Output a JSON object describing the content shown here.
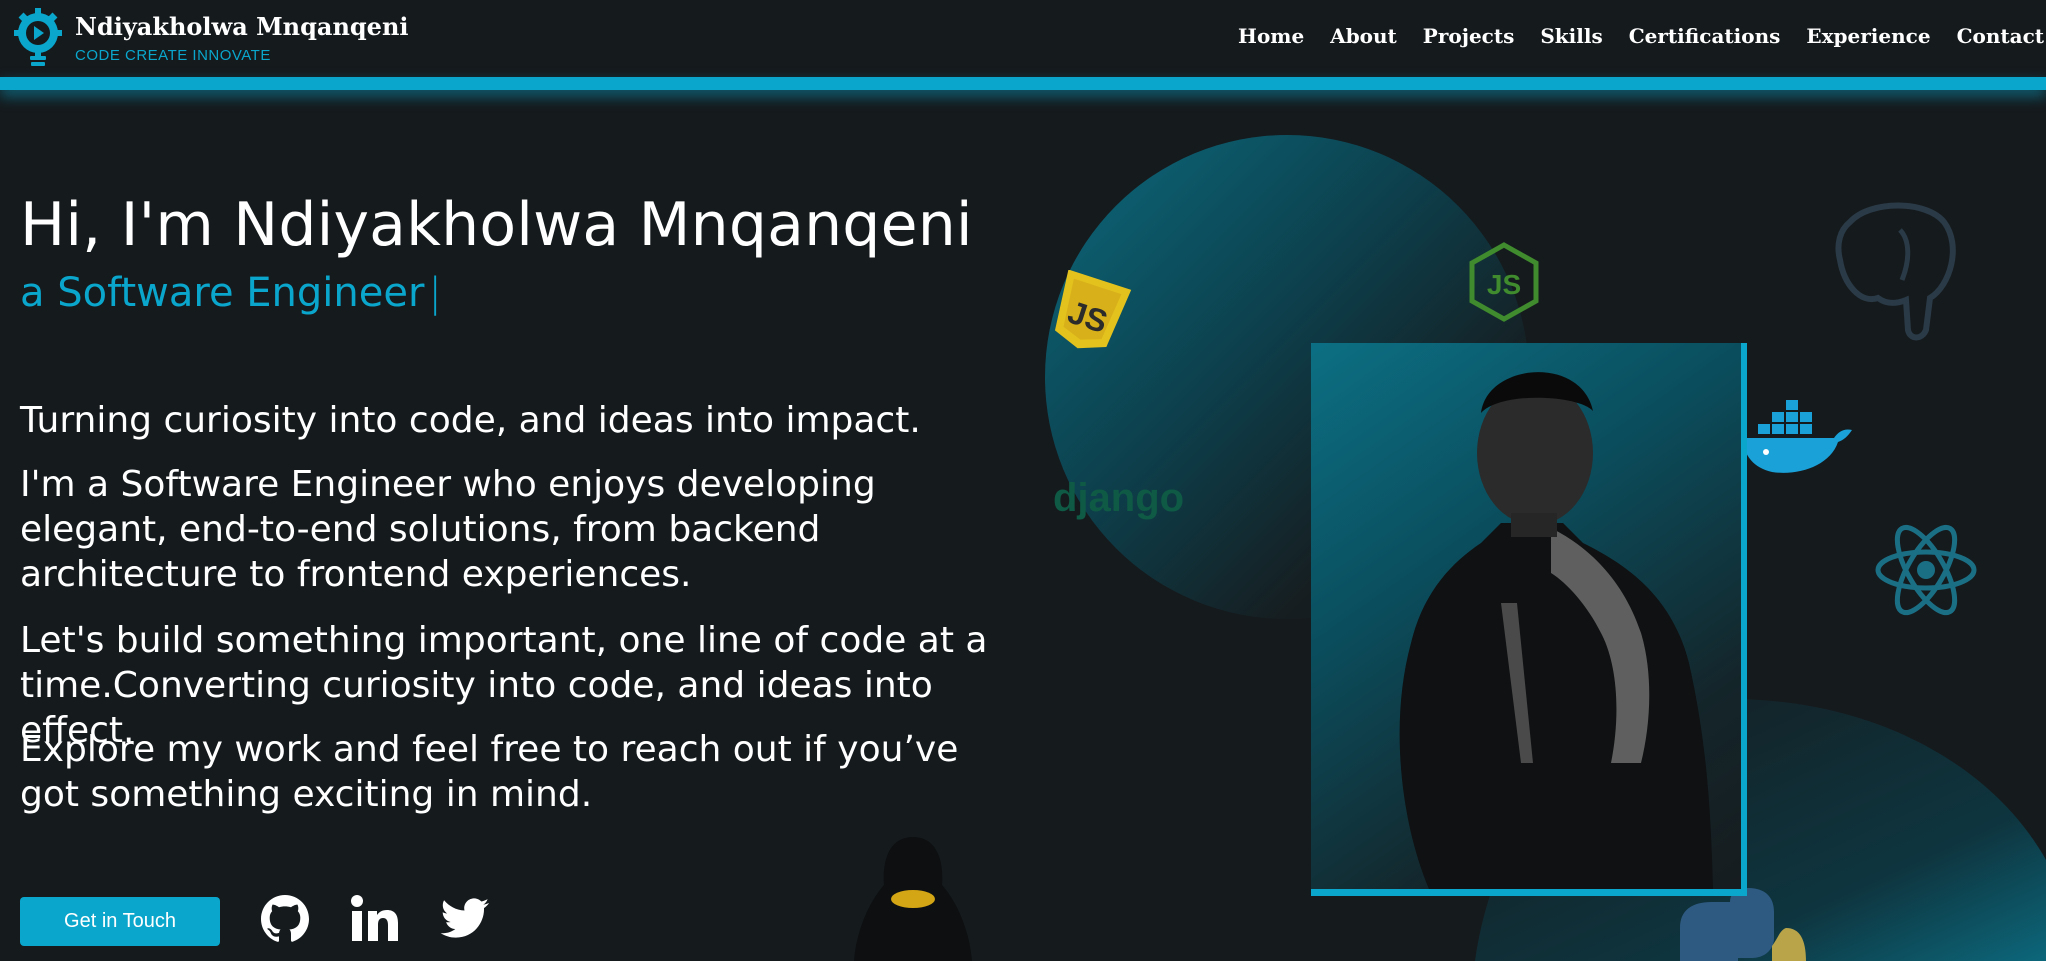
{
  "brand": {
    "name": "Ndiyakholwa Mnqanqeni",
    "tagline": "CODE CREATE INNOVATE"
  },
  "nav": {
    "items": [
      "Home",
      "About",
      "Projects",
      "Skills",
      "Certifications",
      "Experience",
      "Contact"
    ]
  },
  "hero": {
    "title": "Hi, I'm Ndiyakholwa Mnqanqeni",
    "sub_prefix": "a",
    "role": "Software Engineer",
    "cursor": "|",
    "paragraphs": [
      "Turning curiosity into code, and ideas into impact.",
      "I'm a Software Engineer who enjoys developing elegant, end-to-end solutions, from backend architecture to frontend experiences.",
      "Let's build something important, one line of code at a time.Converting curiosity into code, and ideas into effect.",
      "Explore my work and feel free to reach out if you’ve got something exciting in mind."
    ],
    "cta_label": "Get in Touch"
  },
  "social": [
    "github-icon",
    "linkedin-icon",
    "twitter-icon"
  ],
  "art": {
    "django_label": "django",
    "js_label": "JS",
    "node_label": "JS"
  },
  "colors": {
    "accent": "#0aa6cc",
    "background": "#151a1d",
    "text": "#ffffff"
  }
}
